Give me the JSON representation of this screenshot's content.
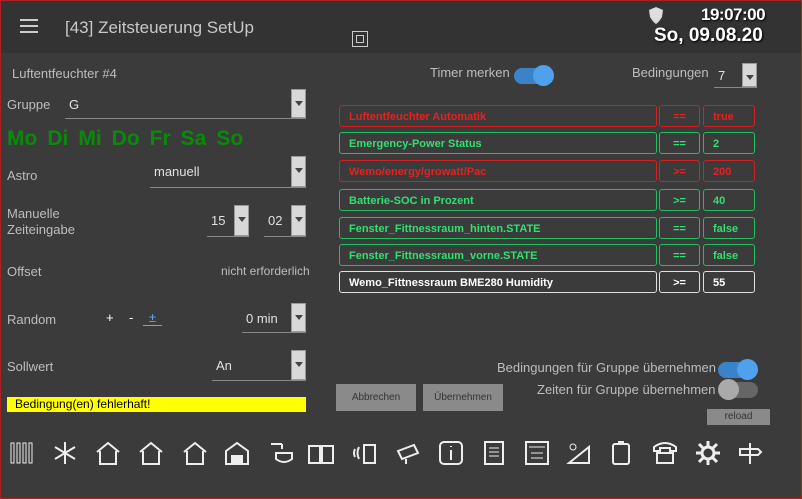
{
  "header": {
    "title": "[43] Zeitsteuerung SetUp",
    "time": "19:07:00",
    "date": "So, 09.08.20"
  },
  "device": {
    "name": "Luftentfeuchter #4"
  },
  "timer": {
    "label": "Timer merken",
    "on": true
  },
  "conditions_count": {
    "label": "Bedingungen",
    "value": "7"
  },
  "gruppe": {
    "label": "Gruppe",
    "value": "G"
  },
  "days": [
    "Mo",
    "Di",
    "Mi",
    "Do",
    "Fr",
    "Sa",
    "So"
  ],
  "astro": {
    "label": "Astro",
    "value": "manuell"
  },
  "manual_time": {
    "label_1": "Manuelle",
    "label_2": "Zeiteingabe",
    "hour": "15",
    "minute": "02"
  },
  "offset": {
    "label": "Offset",
    "value": "nicht erforderlich"
  },
  "random": {
    "label": "Random",
    "plus": "+",
    "minus": "-",
    "plusminus": "±",
    "value": "0 min"
  },
  "sollwert": {
    "label": "Sollwert",
    "value": "An"
  },
  "error": {
    "text": "Bedingung(en) fehlerhaft!"
  },
  "conditions": [
    {
      "name": "Luftentfeuchter Automatik",
      "op": "==",
      "val": "true",
      "status": "red"
    },
    {
      "name": "Emergency-Power Status",
      "op": "==",
      "val": "2",
      "status": "green"
    },
    {
      "name": "Wemo/energy/growatt/Pac",
      "op": ">=",
      "val": "200",
      "status": "red"
    },
    {
      "name": "Batterie-SOC in Prozent",
      "op": ">=",
      "val": "40",
      "status": "green"
    },
    {
      "name": "Fenster_Fittnessraum_hinten.STATE",
      "op": "==",
      "val": "false",
      "status": "green"
    },
    {
      "name": "Fenster_Fittnessraum_vorne.STATE",
      "op": "==",
      "val": "false",
      "status": "green"
    },
    {
      "name": "Wemo_Fittnessraum BME280 Humidity",
      "op": ">=",
      "val": "55",
      "status": "white"
    }
  ],
  "group_options": {
    "conditions_label": "Bedingungen für Gruppe übernehmen",
    "conditions_on": true,
    "times_label": "Zeiten für Gruppe übernehmen",
    "times_on": false
  },
  "buttons": {
    "cancel": "Abbrechen",
    "apply": "Übernehmen",
    "reload": "reload"
  },
  "toolbar": [
    "radiator-icon",
    "snowflake-icon",
    "house-eg-icon",
    "house-og-icon",
    "house-dg-icon",
    "garage-icon",
    "shower-icon",
    "book-icon",
    "signal-icon",
    "camera-icon",
    "info-icon",
    "document-icon",
    "calculator-icon",
    "solar-icon",
    "battery-icon",
    "phone-icon",
    "gear-icon",
    "signpost-icon"
  ],
  "colors": {
    "accent": "#3a83c8",
    "error_bg": "#ffff00",
    "days": "#0a8a0a",
    "red": "#e82020",
    "green": "#30e070"
  }
}
